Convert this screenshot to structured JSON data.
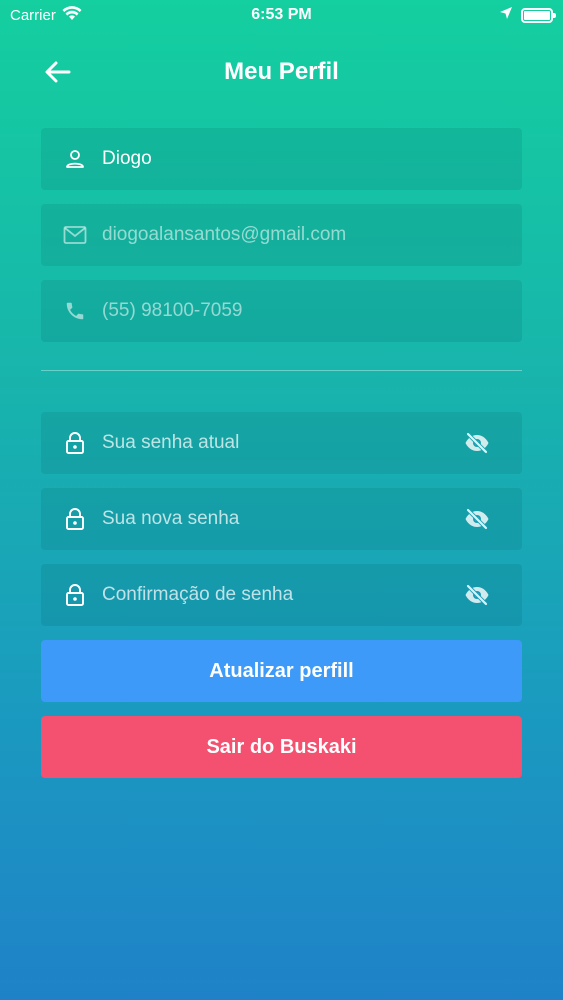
{
  "status_bar": {
    "carrier": "Carrier",
    "time": "6:53 PM"
  },
  "header": {
    "title": "Meu Perfil"
  },
  "profile": {
    "name": "Diogo",
    "email": "diogoalansantos@gmail.com",
    "phone": "(55) 98100-7059"
  },
  "password": {
    "current_placeholder": "Sua senha atual",
    "new_placeholder": "Sua nova senha",
    "confirm_placeholder": "Confirmação de senha"
  },
  "buttons": {
    "update": "Atualizar perfill",
    "logout": "Sair do Buskaki"
  },
  "colors": {
    "update_button": "#3d9af8",
    "logout_button": "#f4506f"
  }
}
